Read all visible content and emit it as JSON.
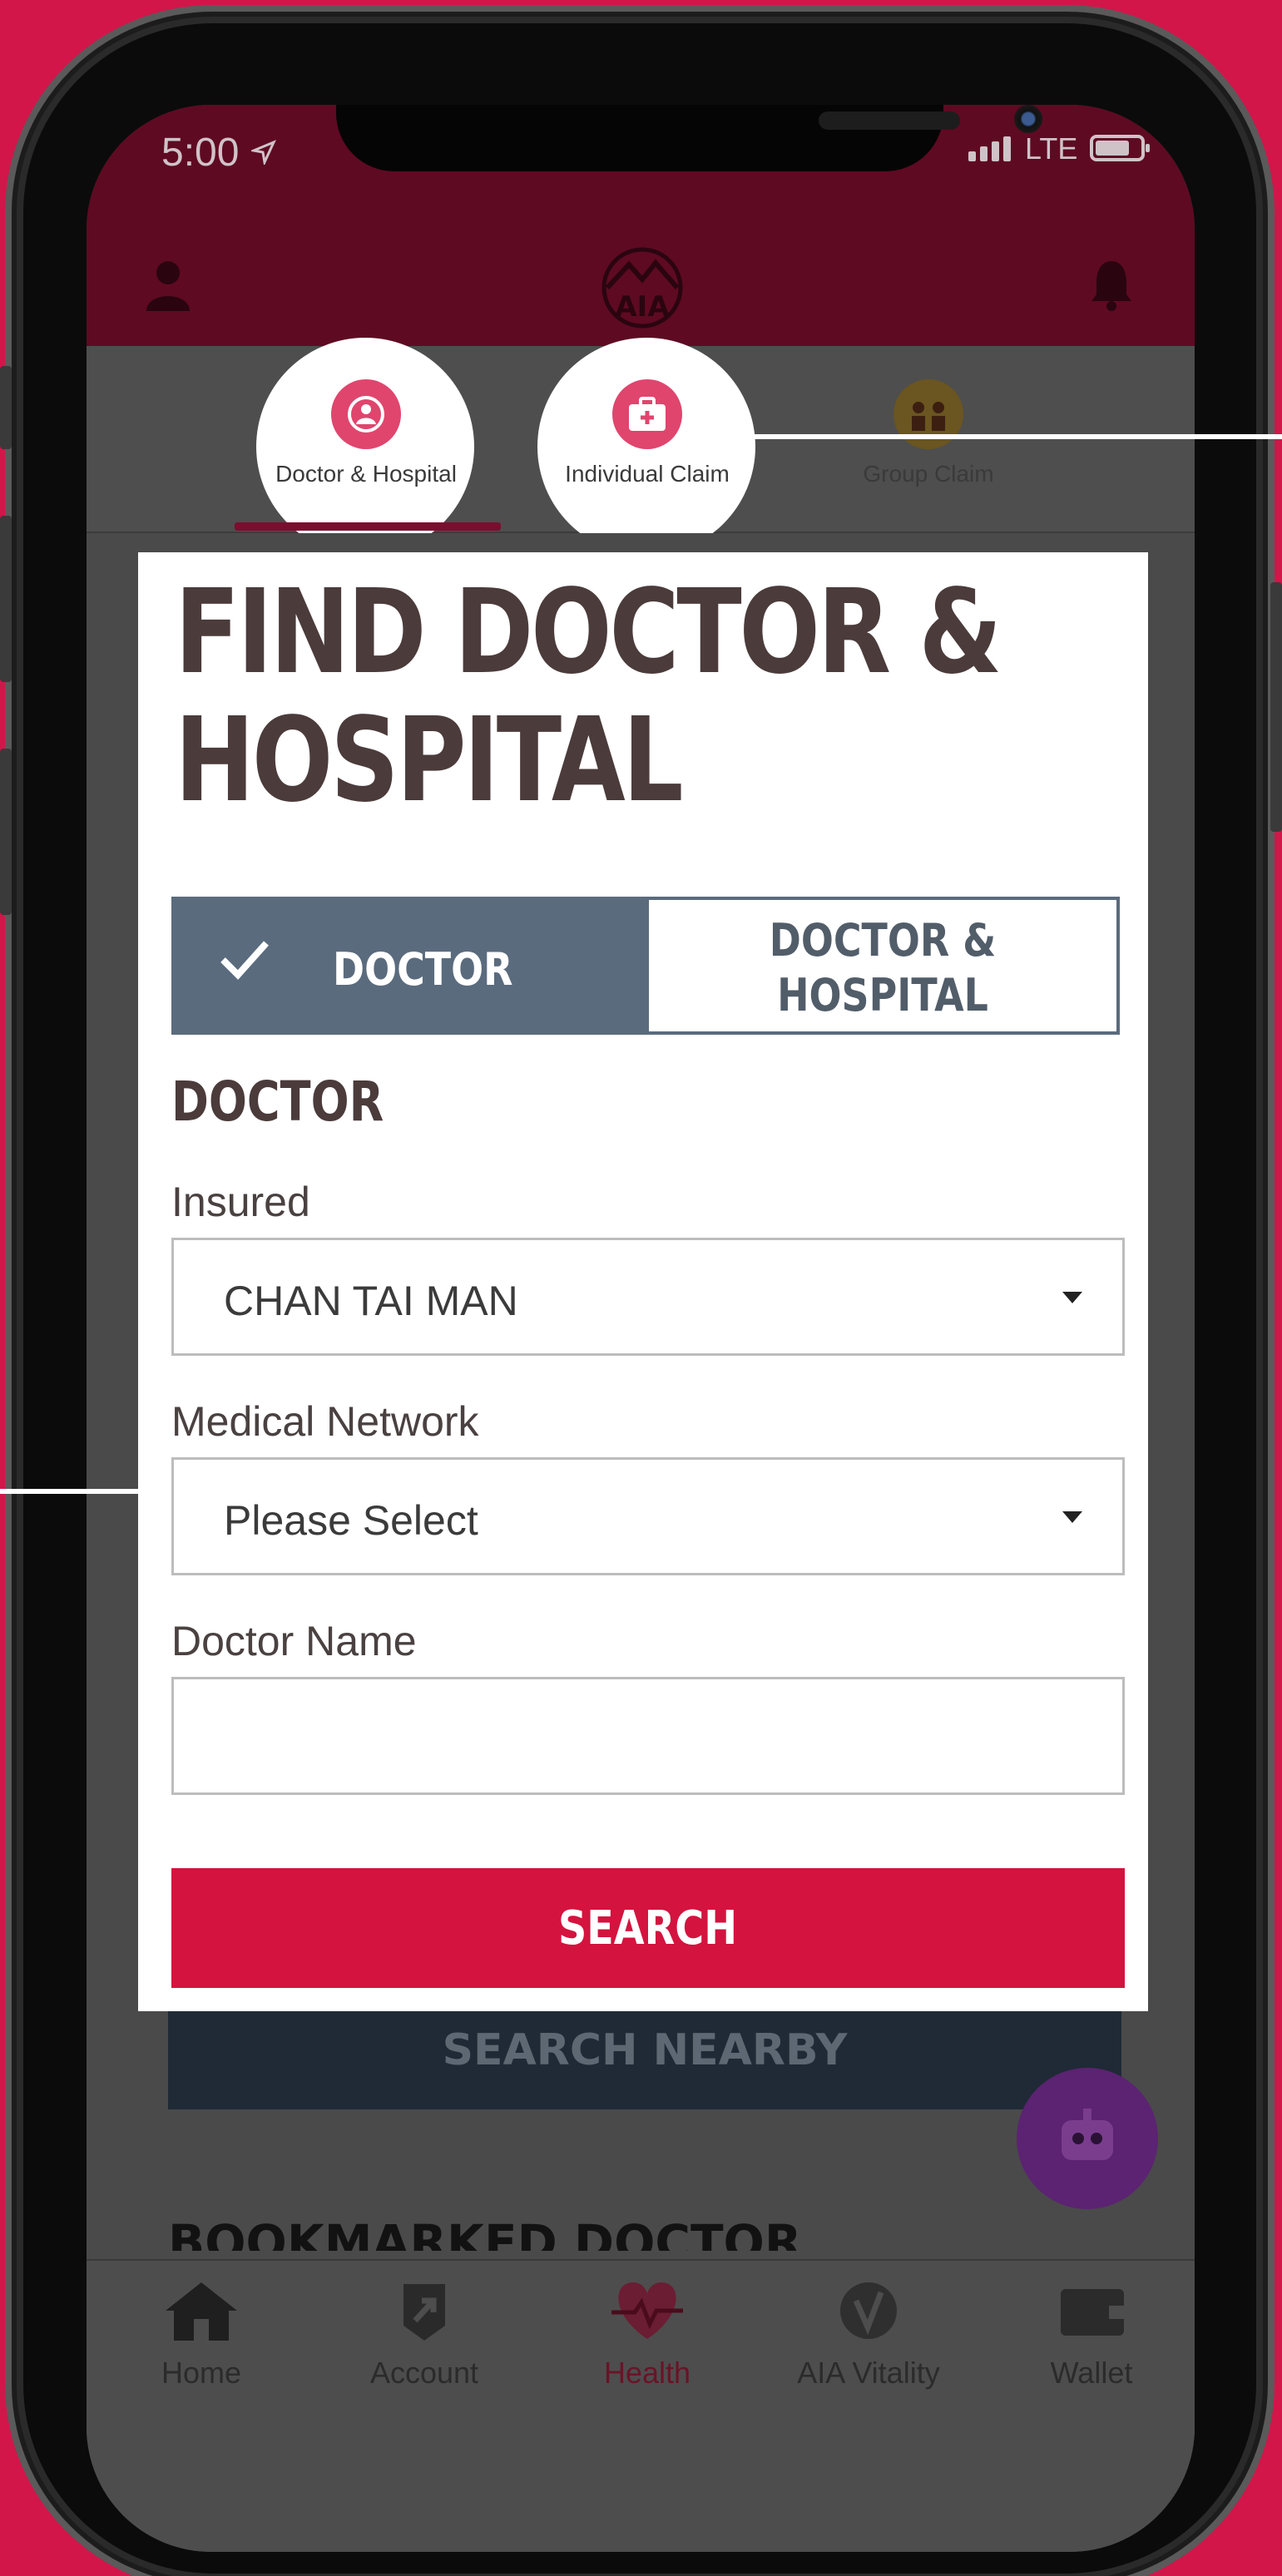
{
  "status_bar": {
    "time": "5:00",
    "network": "LTE"
  },
  "top_tabs": [
    {
      "label": "Doctor & Hospital",
      "active": true
    },
    {
      "label": "Individual Claim",
      "active": false
    },
    {
      "label": "Group Claim",
      "active": false
    }
  ],
  "card": {
    "title_line1": "FIND DOCTOR &",
    "title_line2": "HOSPITAL",
    "toggle_left": "DOCTOR",
    "toggle_right_line1": "DOCTOR &",
    "toggle_right_line2": "HOSPITAL",
    "section_title": "DOCTOR",
    "insured_label": "Insured",
    "insured_value": "CHAN TAI MAN",
    "network_label": "Medical Network",
    "network_value": "Please Select",
    "doctor_name_label": "Doctor Name",
    "doctor_name_value": "",
    "search_label": "SEARCH"
  },
  "search_nearby_label": "SEARCH NEARBY",
  "bookmarked_title": "BOOKMARKED DOCTOR",
  "bottom_nav": [
    {
      "label": "Home",
      "icon": "home-icon"
    },
    {
      "label": "Account",
      "icon": "account-icon"
    },
    {
      "label": "Health",
      "icon": "heart-icon",
      "active": true
    },
    {
      "label": "AIA Vitality",
      "icon": "vitality-icon"
    },
    {
      "label": "Wallet",
      "icon": "wallet-icon"
    }
  ],
  "colors": {
    "brand_red": "#d2164a",
    "header_dark": "#5e0a22",
    "toggle_active": "#5b6b7e",
    "search_button": "#d4133f"
  }
}
